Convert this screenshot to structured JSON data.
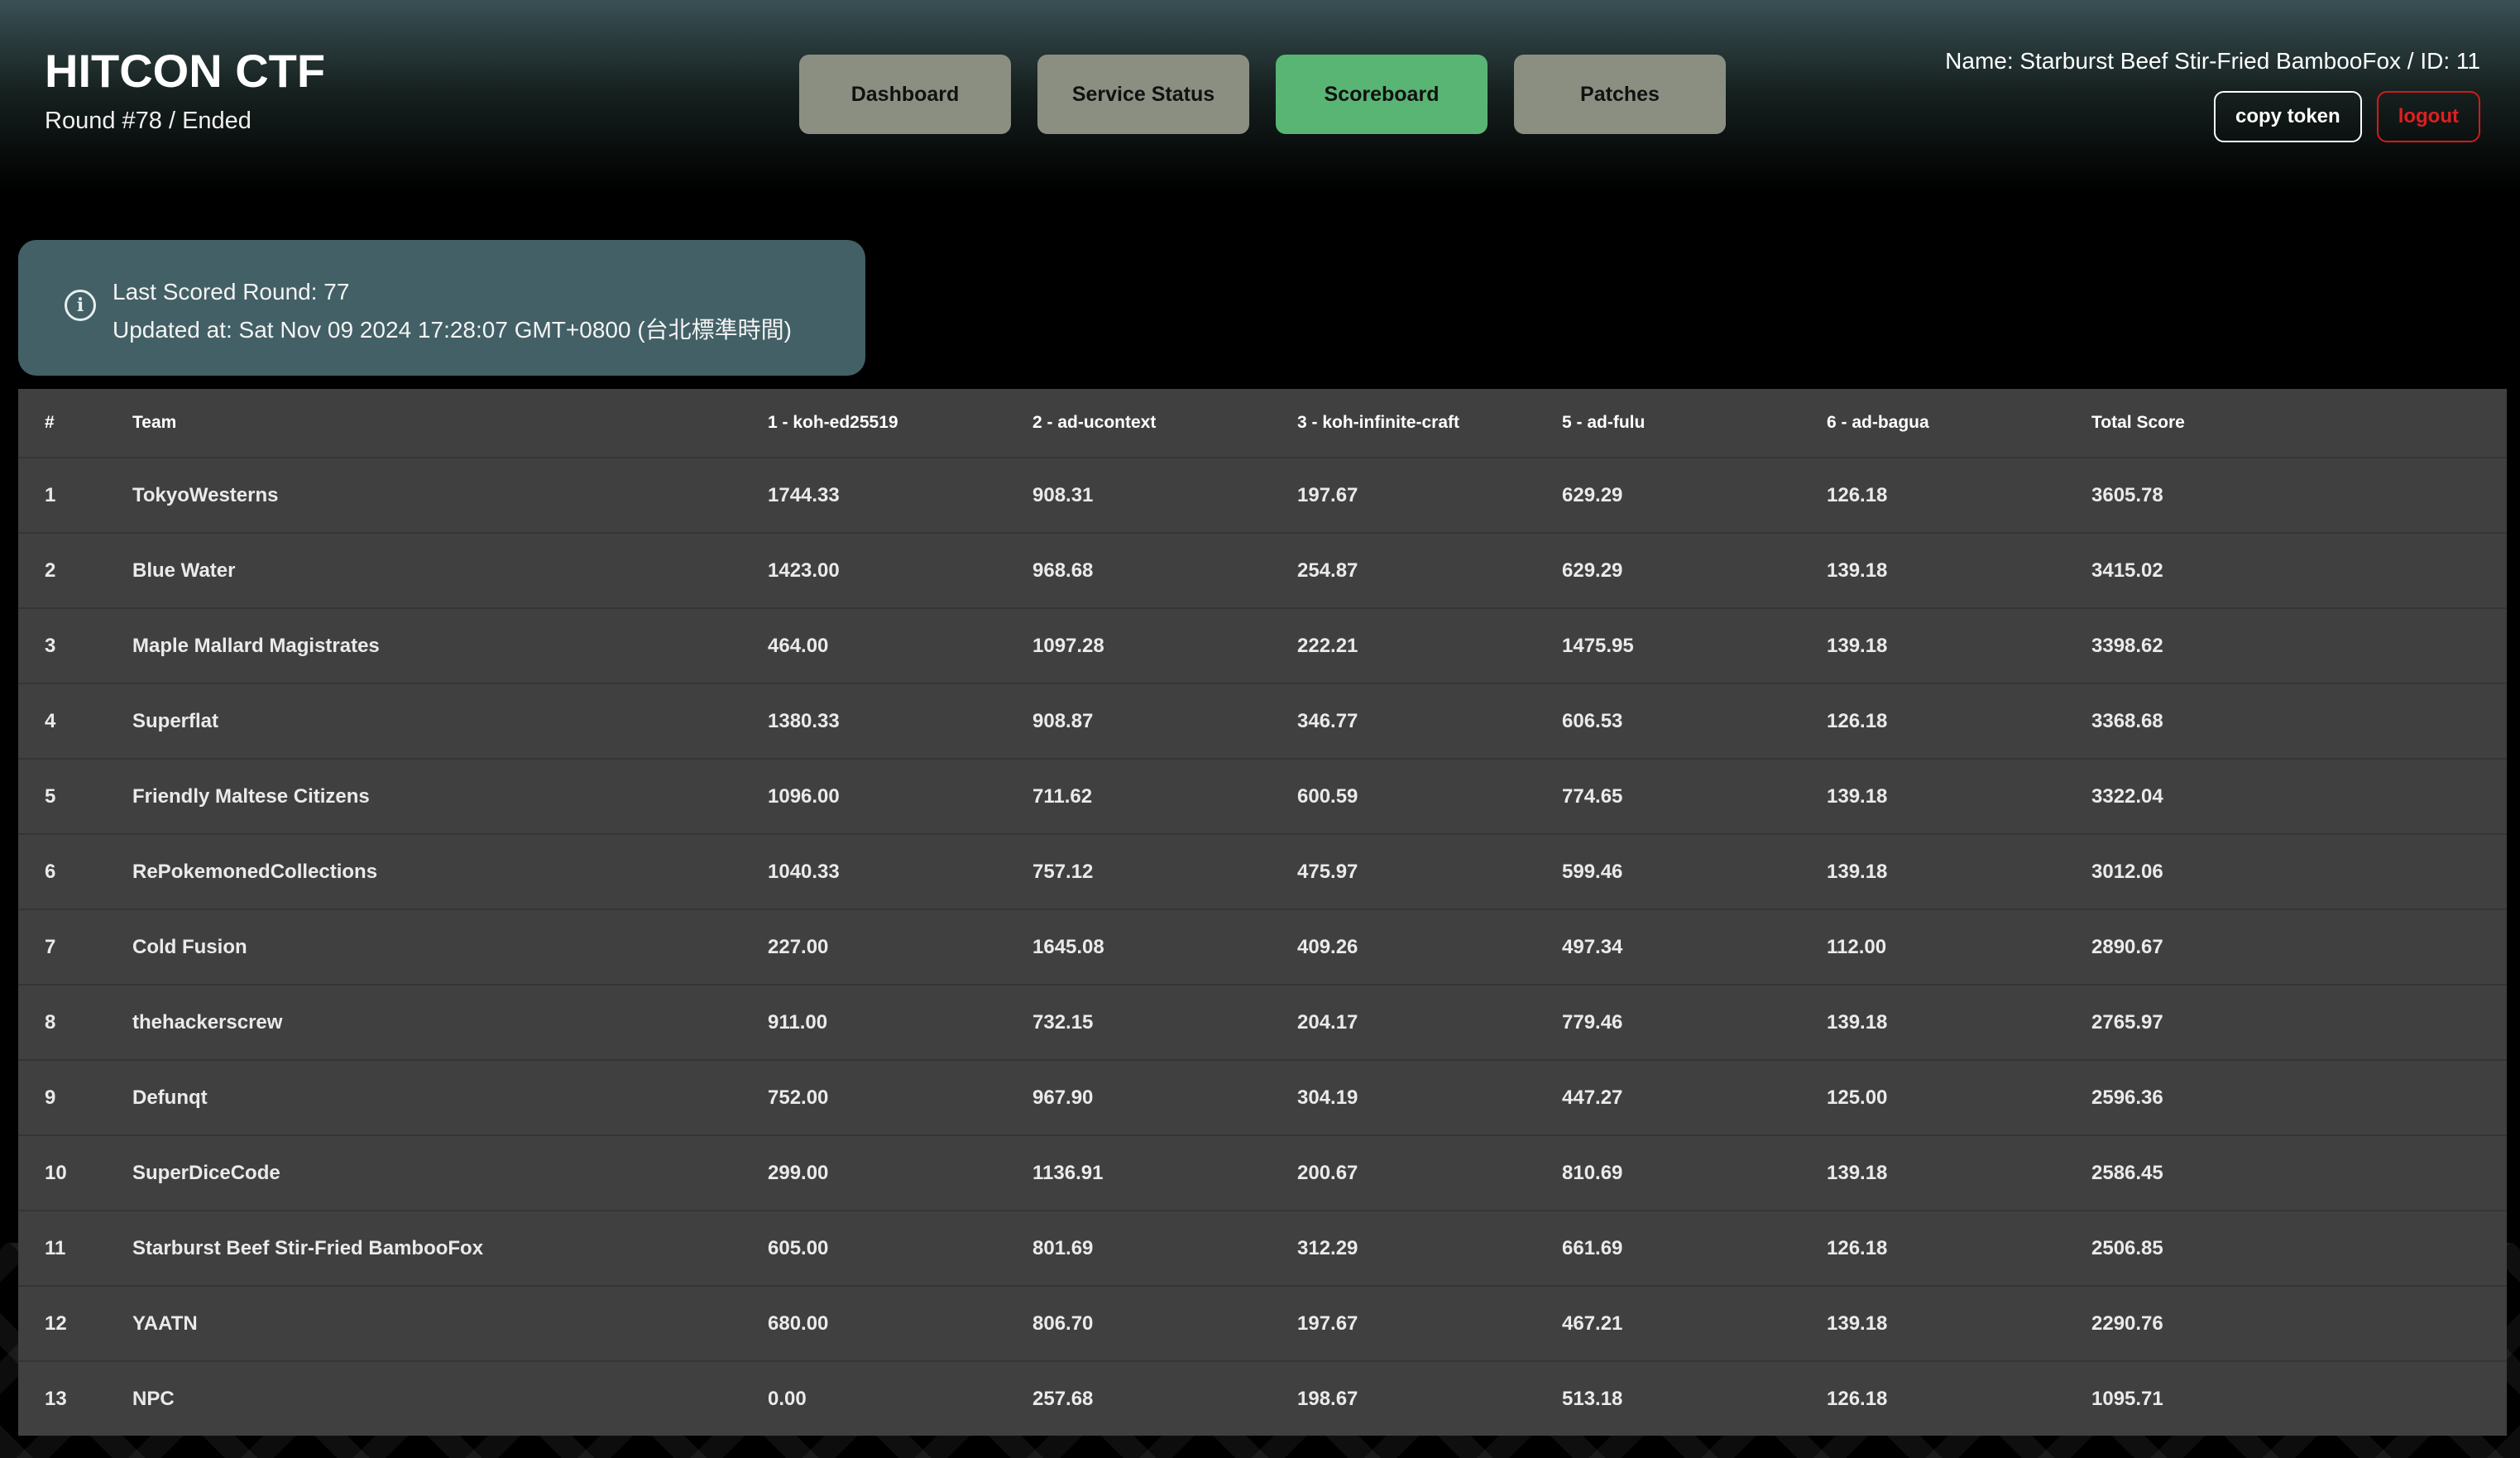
{
  "brand": {
    "title": "HITCON CTF",
    "round": "Round #78 / Ended"
  },
  "nav": {
    "tabs": [
      {
        "label": "Dashboard",
        "active": false
      },
      {
        "label": "Service Status",
        "active": false
      },
      {
        "label": "Scoreboard",
        "active": true
      },
      {
        "label": "Patches",
        "active": false
      }
    ]
  },
  "account": {
    "name": "Name: Starburst Beef Stir-Fried BambooFox / ID: 11",
    "copy_token_label": "copy token",
    "logout_label": "logout"
  },
  "info": {
    "icon": "info-icon",
    "last_scored": "Last Scored Round: 77",
    "updated_at": "Updated at: Sat Nov 09 2024 17:28:07 GMT+0800 (台北標準時間)"
  },
  "table": {
    "headers": [
      "#",
      "Team",
      "1 - koh-ed25519",
      "2 - ad-ucontext",
      "3 - koh-infinite-craft",
      "5 - ad-fulu",
      "6 - ad-bagua",
      "Total Score"
    ],
    "rows": [
      [
        "1",
        "TokyoWesterns",
        "1744.33",
        "908.31",
        "197.67",
        "629.29",
        "126.18",
        "3605.78"
      ],
      [
        "2",
        "Blue Water",
        "1423.00",
        "968.68",
        "254.87",
        "629.29",
        "139.18",
        "3415.02"
      ],
      [
        "3",
        "Maple Mallard Magistrates",
        "464.00",
        "1097.28",
        "222.21",
        "1475.95",
        "139.18",
        "3398.62"
      ],
      [
        "4",
        "Superflat",
        "1380.33",
        "908.87",
        "346.77",
        "606.53",
        "126.18",
        "3368.68"
      ],
      [
        "5",
        "Friendly Maltese Citizens",
        "1096.00",
        "711.62",
        "600.59",
        "774.65",
        "139.18",
        "3322.04"
      ],
      [
        "6",
        "RePokemonedCollections",
        "1040.33",
        "757.12",
        "475.97",
        "599.46",
        "139.18",
        "3012.06"
      ],
      [
        "7",
        "Cold Fusion",
        "227.00",
        "1645.08",
        "409.26",
        "497.34",
        "112.00",
        "2890.67"
      ],
      [
        "8",
        "thehackerscrew",
        "911.00",
        "732.15",
        "204.17",
        "779.46",
        "139.18",
        "2765.97"
      ],
      [
        "9",
        "Defunqt",
        "752.00",
        "967.90",
        "304.19",
        "447.27",
        "125.00",
        "2596.36"
      ],
      [
        "10",
        "SuperDiceCode",
        "299.00",
        "1136.91",
        "200.67",
        "810.69",
        "139.18",
        "2586.45"
      ],
      [
        "11",
        "Starburst Beef Stir-Fried BambooFox",
        "605.00",
        "801.69",
        "312.29",
        "661.69",
        "126.18",
        "2506.85"
      ],
      [
        "12",
        "YAATN",
        "680.00",
        "806.70",
        "197.67",
        "467.21",
        "139.18",
        "2290.76"
      ],
      [
        "13",
        "NPC",
        "0.00",
        "257.68",
        "198.67",
        "513.18",
        "126.18",
        "1095.71"
      ]
    ]
  }
}
